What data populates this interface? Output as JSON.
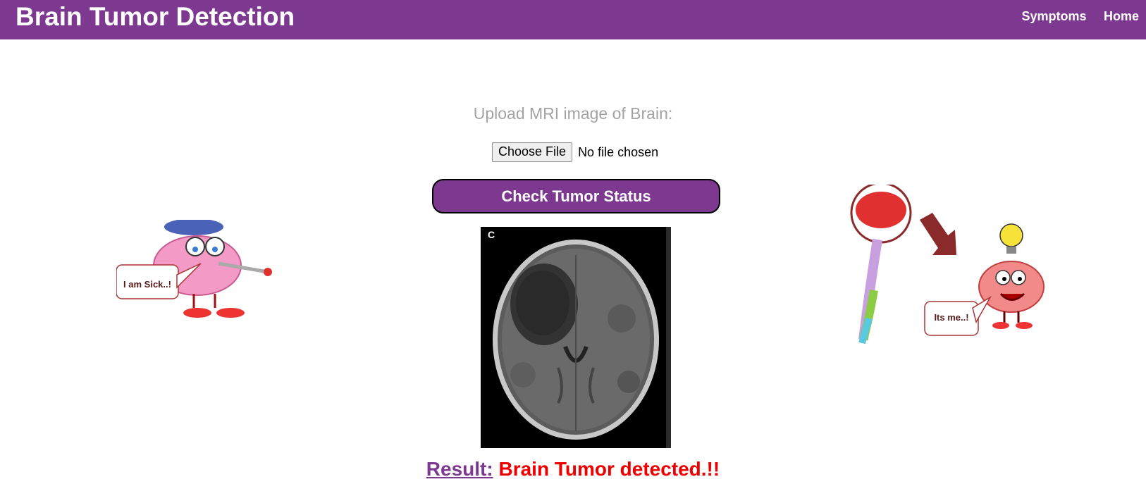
{
  "header": {
    "title": "Brain Tumor Detection",
    "nav": [
      "Symptoms",
      "Home"
    ]
  },
  "upload": {
    "label": "Upload MRI image of Brain:",
    "button_label": "Choose File",
    "status": "No file chosen"
  },
  "action": {
    "check_label": "Check Tumor Status"
  },
  "image": {
    "panel_letter": "C"
  },
  "result": {
    "label": "Result:",
    "value": "Brain Tumor detected.!!"
  },
  "illustrations": {
    "left_bubble": "I am Sick..!",
    "right_bubble": "Its me..!"
  },
  "colors": {
    "brand": "#7d3890",
    "alert": "#ee0000",
    "muted": "#a3a3a3"
  }
}
